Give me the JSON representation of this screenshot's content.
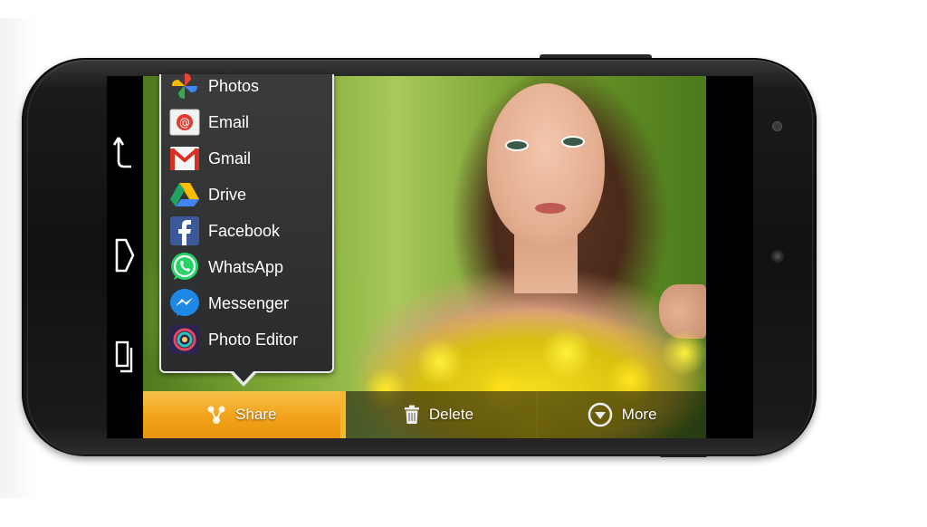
{
  "share_menu": {
    "items": [
      {
        "label": "Photos",
        "icon": "google-photos-icon"
      },
      {
        "label": "Email",
        "icon": "email-icon"
      },
      {
        "label": "Gmail",
        "icon": "gmail-icon"
      },
      {
        "label": "Drive",
        "icon": "google-drive-icon"
      },
      {
        "label": "Facebook",
        "icon": "facebook-icon"
      },
      {
        "label": "WhatsApp",
        "icon": "whatsapp-icon"
      },
      {
        "label": "Messenger",
        "icon": "messenger-icon"
      },
      {
        "label": "Photo Editor",
        "icon": "photo-editor-icon"
      }
    ]
  },
  "action_bar": {
    "share_label": "Share",
    "delete_label": "Delete",
    "more_label": "More"
  },
  "nav_bar": {
    "buttons": [
      "back-arrow-icon",
      "home-icon",
      "recents-icon"
    ]
  },
  "colors": {
    "share_accent": "#f2a21a",
    "popup_bg": "#2f3032",
    "popup_border": "#e8e8e8"
  }
}
